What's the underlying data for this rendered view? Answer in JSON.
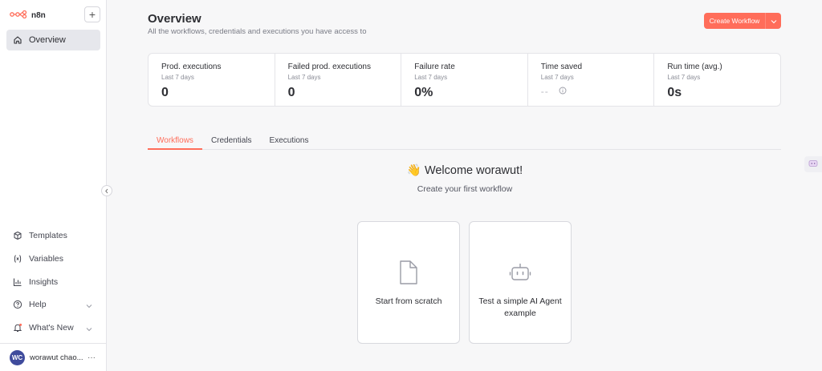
{
  "app": {
    "logo_text": "n8n",
    "brand_color": "#ff6d5a"
  },
  "sidebar": {
    "add_label": "+",
    "primary": {
      "label": "Overview",
      "icon": "home-icon"
    },
    "items": [
      {
        "label": "Templates",
        "icon": "box-icon",
        "has_chevron": false
      },
      {
        "label": "Variables",
        "icon": "variables-icon",
        "has_chevron": false
      },
      {
        "label": "Insights",
        "icon": "chart-icon",
        "has_chevron": false
      },
      {
        "label": "Help",
        "icon": "help-icon",
        "has_chevron": true
      },
      {
        "label": "What's New",
        "icon": "bell-icon",
        "has_chevron": true
      }
    ],
    "user": {
      "initials": "WC",
      "name": "worawut chao...",
      "more": "···"
    }
  },
  "header": {
    "title": "Overview",
    "subtitle": "All the workflows, credentials and executions you have access to",
    "create_button": "Create Workflow"
  },
  "stats": [
    {
      "title": "Prod. executions",
      "period": "Last 7 days",
      "value": "0"
    },
    {
      "title": "Failed prod. executions",
      "period": "Last 7 days",
      "value": "0"
    },
    {
      "title": "Failure rate",
      "period": "Last 7 days",
      "value": "0%"
    },
    {
      "title": "Time saved",
      "period": "Last 7 days",
      "value": "--"
    },
    {
      "title": "Run time (avg.)",
      "period": "Last 7 days",
      "value": "0s"
    }
  ],
  "tabs": [
    {
      "label": "Workflows",
      "active": true
    },
    {
      "label": "Credentials",
      "active": false
    },
    {
      "label": "Executions",
      "active": false
    }
  ],
  "welcome": {
    "emoji": "👋",
    "title": "Welcome worawut!",
    "subtitle": "Create your first workflow"
  },
  "cards": [
    {
      "label": "Start from scratch",
      "icon": "file-icon"
    },
    {
      "label": "Test a simple AI Agent example",
      "icon": "robot-icon"
    }
  ]
}
